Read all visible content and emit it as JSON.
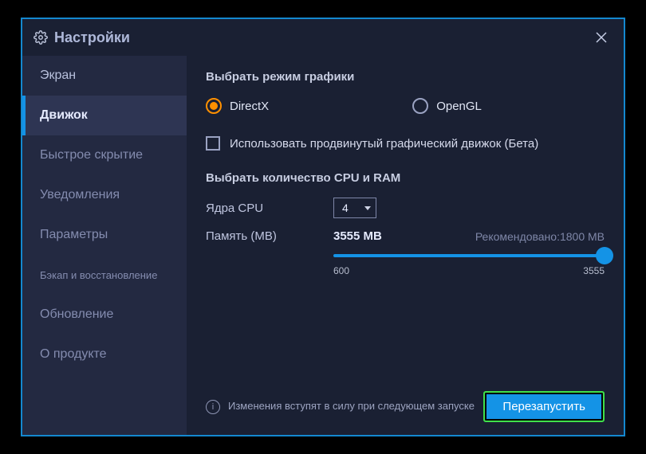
{
  "titlebar": {
    "title": "Настройки"
  },
  "sidebar": {
    "items": [
      {
        "label": "Экран"
      },
      {
        "label": "Движок"
      },
      {
        "label": "Быстрое скрытие"
      },
      {
        "label": "Уведомления"
      },
      {
        "label": "Параметры"
      },
      {
        "label": "Бэкап и восстановление"
      },
      {
        "label": "Обновление"
      },
      {
        "label": "О продукте"
      }
    ]
  },
  "graphics": {
    "section_title": "Выбрать режим графики",
    "directx_label": "DirectX",
    "opengl_label": "OpenGL",
    "advanced_label": "Использовать продвинутый графический движок (Бета)"
  },
  "cpu_ram": {
    "section_title": "Выбрать количество CPU и RAM",
    "cores_label": "Ядра CPU",
    "cores_value": "4",
    "memory_label": "Память (MB)",
    "memory_value": "3555 MB",
    "memory_recommended": "Рекомендовано:1800 MB",
    "slider_min": "600",
    "slider_max": "3555"
  },
  "footer": {
    "info_text": "Изменения вступят в силу при следующем запуске",
    "restart_label": "Перезапустить"
  }
}
